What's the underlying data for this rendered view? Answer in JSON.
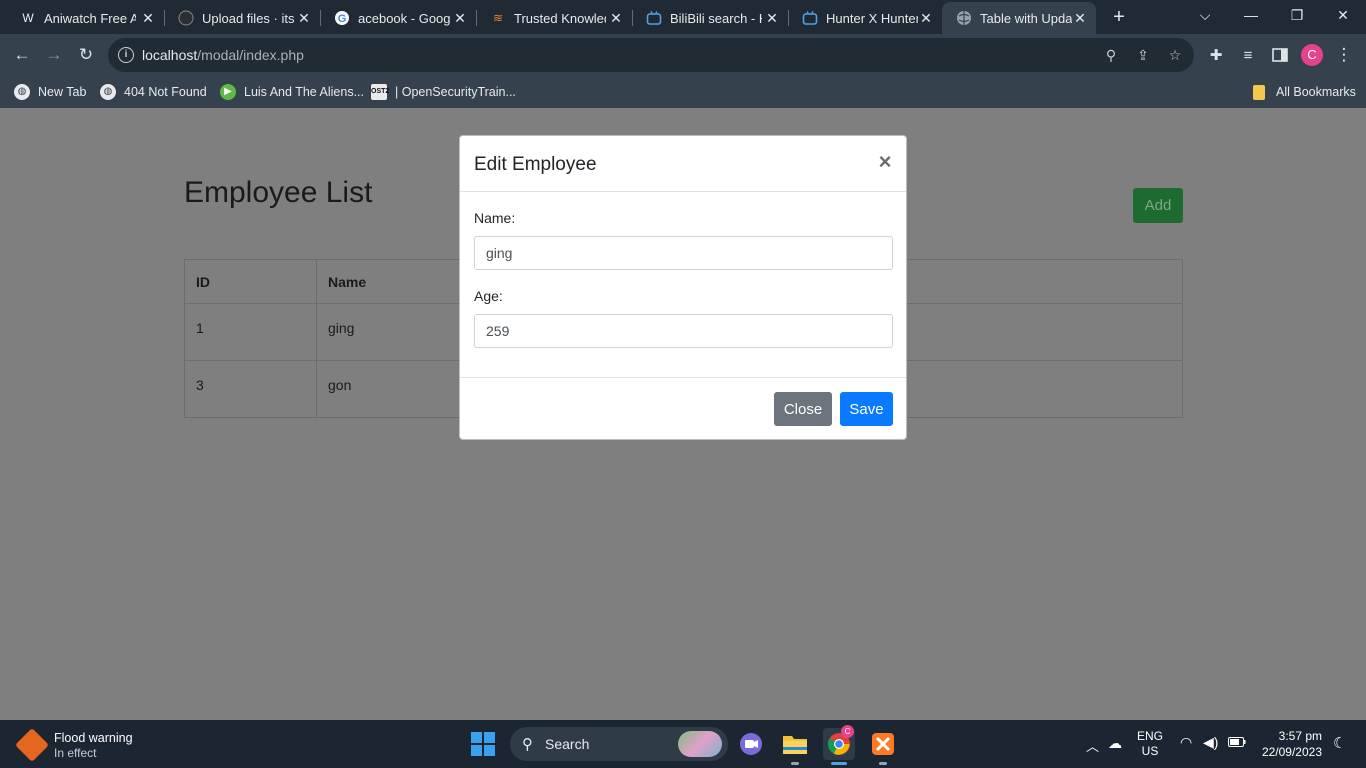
{
  "browser": {
    "tabs": [
      {
        "title": "Aniwatch Free An",
        "icon": "aniwatch-icon",
        "active": false
      },
      {
        "title": "Upload files · itsc",
        "icon": "github-icon",
        "active": false
      },
      {
        "title": "acebook - Googl",
        "icon": "google-icon",
        "active": false
      },
      {
        "title": "Trusted Knowled",
        "icon": "stackoverflow-icon",
        "active": false
      },
      {
        "title": "BiliBili search - H",
        "icon": "bilibili-icon",
        "active": false
      },
      {
        "title": "Hunter X Hunter",
        "icon": "bilibili-icon",
        "active": false
      },
      {
        "title": "Table with Updat",
        "icon": "globe-icon",
        "active": true
      }
    ],
    "url_host": "localhost",
    "url_path": "/modal/index.php",
    "profile_initial": "C",
    "bookmarks": [
      {
        "label": "New Tab"
      },
      {
        "label": "404 Not Found"
      },
      {
        "label": "Luis And The Aliens..."
      },
      {
        "label": "| OpenSecurityTrain..."
      }
    ],
    "all_bookmarks": "All Bookmarks"
  },
  "page": {
    "title": "Employee List",
    "add_label": "Add",
    "table": {
      "headers": [
        "ID",
        "Name",
        ""
      ],
      "rows": [
        {
          "id": "1",
          "name": "ging"
        },
        {
          "id": "3",
          "name": "gon"
        }
      ]
    }
  },
  "modal": {
    "title": "Edit Employee",
    "close_symbol": "×",
    "name_label": "Name:",
    "name_value": "ging",
    "age_label": "Age:",
    "age_value": "259",
    "close_label": "Close",
    "save_label": "Save"
  },
  "taskbar": {
    "weather_title": "Flood warning",
    "weather_sub": "In effect",
    "search_label": "Search",
    "language": "ENG",
    "region": "US",
    "time": "3:57 pm",
    "date": "22/09/2023",
    "chrome_badge": "C"
  },
  "colors": {
    "accent_blue": "#0a7bff",
    "add_green": "#1d6b30",
    "close_gray": "#6c757d",
    "overlay": "#7f7f7f"
  }
}
